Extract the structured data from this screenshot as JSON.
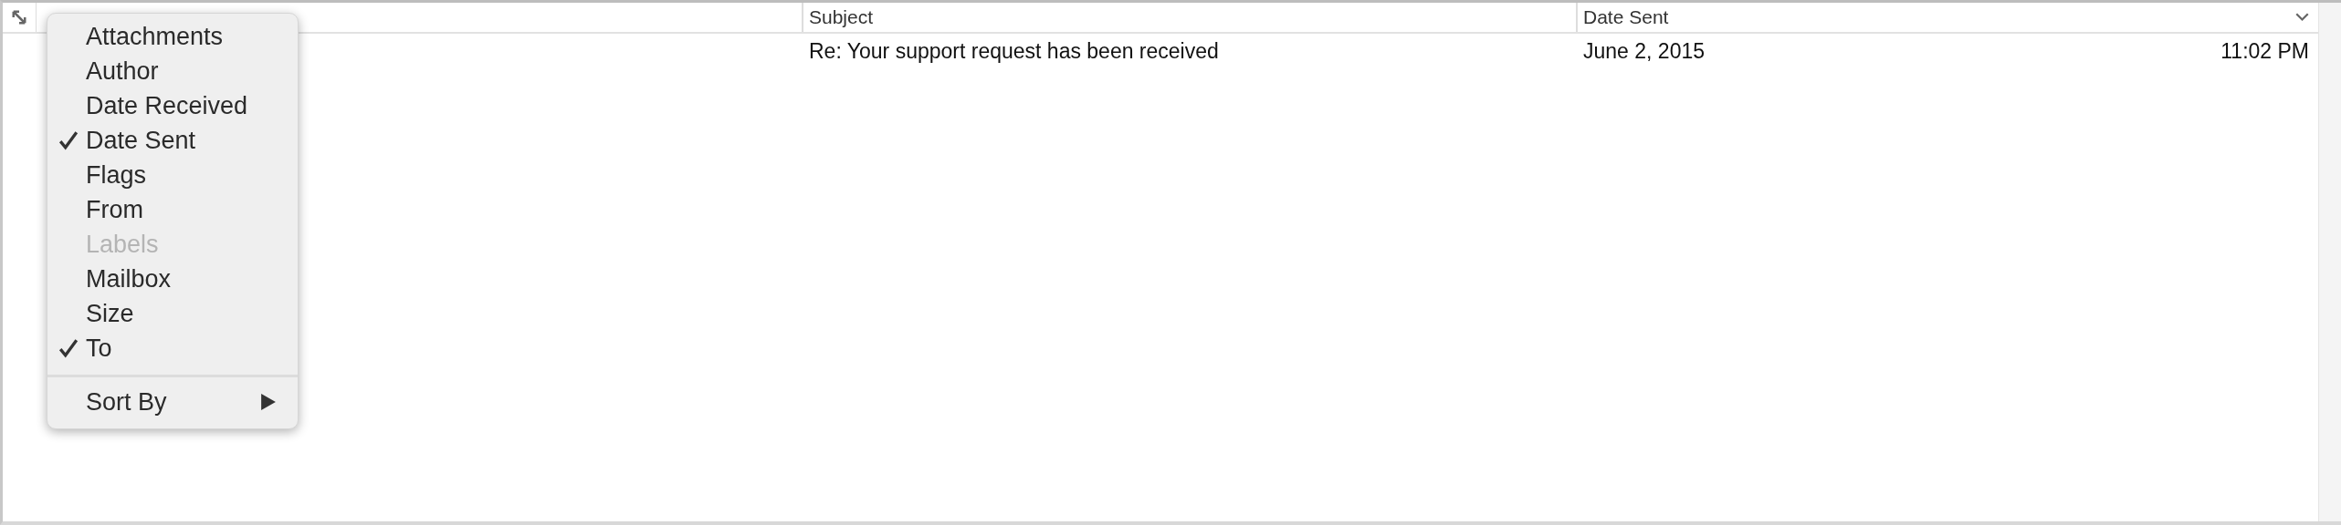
{
  "table": {
    "columns": [
      {
        "label": "Subject",
        "sorted": false
      },
      {
        "label": "Date Sent",
        "sorted": true
      }
    ],
    "rows": [
      {
        "subject": "Re: Your support request has been received",
        "date": "June 2, 2015",
        "time": "11:02 PM"
      }
    ]
  },
  "menu": {
    "items": [
      {
        "label": "Attachments",
        "checked": false,
        "disabled": false
      },
      {
        "label": "Author",
        "checked": false,
        "disabled": false
      },
      {
        "label": "Date Received",
        "checked": false,
        "disabled": false
      },
      {
        "label": "Date Sent",
        "checked": true,
        "disabled": false
      },
      {
        "label": "Flags",
        "checked": false,
        "disabled": false
      },
      {
        "label": "From",
        "checked": false,
        "disabled": false
      },
      {
        "label": "Labels",
        "checked": false,
        "disabled": true
      },
      {
        "label": "Mailbox",
        "checked": false,
        "disabled": false
      },
      {
        "label": "Size",
        "checked": false,
        "disabled": false
      },
      {
        "label": "To",
        "checked": true,
        "disabled": false
      }
    ],
    "submenu": {
      "label": "Sort By"
    }
  }
}
